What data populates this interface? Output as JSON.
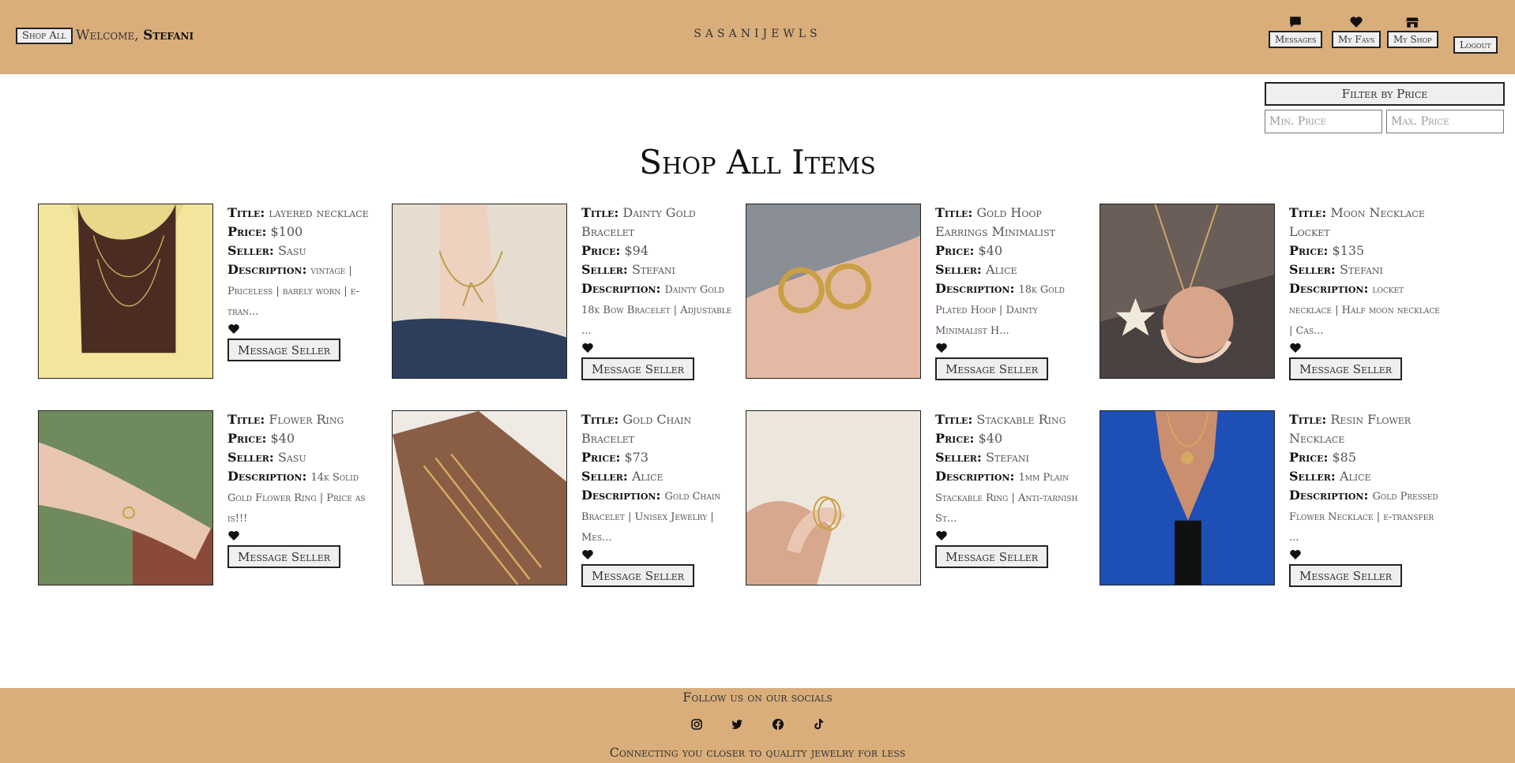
{
  "header": {
    "shop_all": "Shop All",
    "welcome_prefix": "Welcome,",
    "user": "Stefani",
    "brand": "SASANIJEWLS",
    "nav": {
      "messages": "Messages",
      "favs": "My Favs",
      "shop": "My Shop",
      "logout": "Logout"
    }
  },
  "filter": {
    "button": "Filter by Price",
    "min_placeholder": "Min. Price",
    "max_placeholder": "Max. Price"
  },
  "page_title": "Shop All Items",
  "labels": {
    "title": "Title:",
    "price": "Price:",
    "seller": "Seller:",
    "description": "Description:",
    "message_seller": "Message Seller"
  },
  "items": [
    {
      "title": "layered necklace",
      "price": "$100",
      "seller": "Sasu",
      "description": "vintage | Priceless | barely worn | e-tran...",
      "image": "necklace-yellow-top"
    },
    {
      "title": "Dainty Gold Bracelet",
      "price": "$94",
      "seller": "Stefani",
      "description": "Dainty Gold 18k Bow Bracelet | Adjustable ...",
      "image": "bow-bracelet"
    },
    {
      "title": "Gold Hoop Earrings Minimalist",
      "price": "$40",
      "seller": "Alice",
      "description": "18k Gold Plated Hoop | Dainty Minimalist H...",
      "image": "hoop-earrings"
    },
    {
      "title": "Moon Necklace Locket",
      "price": "$135",
      "seller": "Stefani",
      "description": "locket necklace | Half moon necklace | Cas...",
      "image": "moon-locket"
    },
    {
      "title": "Flower Ring",
      "price": "$40",
      "seller": "Sasu",
      "description": "14k Solid Gold Flower Ring | Price as is!!!",
      "image": "flower-ring"
    },
    {
      "title": "Gold Chain Bracelet",
      "price": "$73",
      "seller": "Alice",
      "description": "Gold Chain Bracelet | Unisex Jewelry | Mes...",
      "image": "chain-bracelet"
    },
    {
      "title": "Stackable Ring",
      "price": "$40",
      "seller": "Stefani",
      "description": "1mm Plain Stackable Ring | Anti-tarnish St...",
      "image": "stackable-ring"
    },
    {
      "title": "Resin Flower Necklace",
      "price": "$85",
      "seller": "Alice",
      "description": "Gold Pressed Flower Necklace | e-transfer ...",
      "image": "resin-necklace"
    }
  ],
  "footer": {
    "follow": "Follow us on our socials",
    "tagline": "Connecting you closer to quality jewelry for less",
    "socials": [
      "instagram-icon",
      "twitter-icon",
      "facebook-icon",
      "tiktok-icon"
    ]
  },
  "colors": {
    "header_bg": "#d9ae7b",
    "button_bg": "#efefef"
  }
}
